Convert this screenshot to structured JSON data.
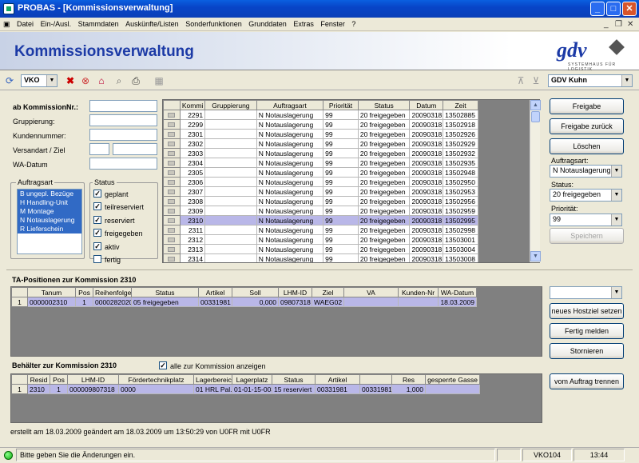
{
  "window": {
    "title": "PROBAS - [Kommissionsverwaltung]"
  },
  "menu": [
    "Datei",
    "Ein-/Ausl.",
    "Stammdaten",
    "Auskünfte/Listen",
    "Sonderfunktionen",
    "Grunddaten",
    "Extras",
    "Fenster",
    "?"
  ],
  "banner": {
    "title": "Kommissionsverwaltung",
    "logo": "gdv",
    "logo_sub": "SYSTEMHAUS FÜR LOGISTIK"
  },
  "toolbar": {
    "mode": "VKO",
    "user": "GDV Kuhn"
  },
  "filter": {
    "ab_label": "ab KommissionNr.:",
    "grupp_label": "Gruppierung:",
    "kunden_label": "Kundennummer:",
    "versand_label": "Versandart / Ziel",
    "wa_label": "WA-Datum",
    "auftragsart_title": "Auftragsart",
    "auftragsart": [
      "B  ungepl. Bezüge",
      "H  Handling-Unit",
      "M  Montage",
      "N  Notauslagerung",
      "R  Lieferschein"
    ],
    "status_title": "Status",
    "status": [
      {
        "label": "geplant",
        "checked": true
      },
      {
        "label": "teilreserviert",
        "checked": true
      },
      {
        "label": "reserviert",
        "checked": true
      },
      {
        "label": "freigegeben",
        "checked": true
      },
      {
        "label": "aktiv",
        "checked": true
      },
      {
        "label": "fertig",
        "checked": false
      }
    ]
  },
  "main_grid": {
    "columns": [
      "Kommi",
      "Gruppierung",
      "Auftragsart",
      "Priorität",
      "Status",
      "Datum",
      "Zeit"
    ],
    "rows": [
      [
        "2291",
        "",
        "N  Notauslagerung",
        "99",
        "20 freigegeben",
        "20090318",
        "13502885"
      ],
      [
        "2299",
        "",
        "N  Notauslagerung",
        "99",
        "20 freigegeben",
        "20090318",
        "13502918"
      ],
      [
        "2301",
        "",
        "N  Notauslagerung",
        "99",
        "20 freigegeben",
        "20090318",
        "13502926"
      ],
      [
        "2302",
        "",
        "N  Notauslagerung",
        "99",
        "20 freigegeben",
        "20090318",
        "13502929"
      ],
      [
        "2303",
        "",
        "N  Notauslagerung",
        "99",
        "20 freigegeben",
        "20090318",
        "13502932"
      ],
      [
        "2304",
        "",
        "N  Notauslagerung",
        "99",
        "20 freigegeben",
        "20090318",
        "13502935"
      ],
      [
        "2305",
        "",
        "N  Notauslagerung",
        "99",
        "20 freigegeben",
        "20090318",
        "13502948"
      ],
      [
        "2306",
        "",
        "N  Notauslagerung",
        "99",
        "20 freigegeben",
        "20090318",
        "13502950"
      ],
      [
        "2307",
        "",
        "N  Notauslagerung",
        "99",
        "20 freigegeben",
        "20090318",
        "13502953"
      ],
      [
        "2308",
        "",
        "N  Notauslagerung",
        "99",
        "20 freigegeben",
        "20090318",
        "13502956"
      ],
      [
        "2309",
        "",
        "N  Notauslagerung",
        "99",
        "20 freigegeben",
        "20090318",
        "13502959"
      ],
      [
        "2310",
        "",
        "N  Notauslagerung",
        "99",
        "20 freigegeben",
        "20090318",
        "13502995"
      ],
      [
        "2311",
        "",
        "N  Notauslagerung",
        "99",
        "20 freigegeben",
        "20090318",
        "13502998"
      ],
      [
        "2312",
        "",
        "N  Notauslagerung",
        "99",
        "20 freigegeben",
        "20090318",
        "13503001"
      ],
      [
        "2313",
        "",
        "N  Notauslagerung",
        "99",
        "20 freigegeben",
        "20090318",
        "13503004"
      ],
      [
        "2314",
        "",
        "N  Notauslagerung",
        "99",
        "20 freigegeben",
        "20090318",
        "13503008"
      ]
    ],
    "selected_row": 11
  },
  "right_panel": {
    "freigabe": "Freigabe",
    "freigabe_zurueck": "Freigabe zurück",
    "loeschen": "Löschen",
    "auftragsart_label": "Auftragsart:",
    "auftragsart_value": "N  Notauslagerung",
    "status_label": "Status:",
    "status_value": "20 freigegeben",
    "prio_label": "Priorität:",
    "prio_value": "99",
    "speichern": "Speichern"
  },
  "ta": {
    "title": "TA-Positionen zur Kommission  2310",
    "columns": [
      "Tanum",
      "Pos",
      "Reihenfolge",
      "Status",
      "Artikel",
      "Soll",
      "LHM-ID",
      "Ziel",
      "VA",
      "Kunden-Nr",
      "WA-Datum"
    ],
    "rows": [
      [
        "1",
        "0000002310",
        "1",
        "0000282020",
        "05 freigegeben",
        "00331981",
        "0,000",
        "09807318",
        "WAEG02",
        "",
        "",
        "18.03.2009"
      ]
    ],
    "hostziel": "",
    "btn_hostziel": "neues Hostziel setzen",
    "btn_fertig": "Fertig melden",
    "btn_storno": "Stornieren"
  },
  "beh": {
    "title": "Behälter zur Kommission  2310",
    "alle_label": "alle zur Kommission anzeigen",
    "alle_checked": true,
    "columns": [
      "Resid",
      "Pos",
      "LHM-ID",
      "Fördertechnikplatz",
      "Lagerbereic",
      "Lagerplatz",
      "Status",
      "Artikel",
      "",
      "Res",
      "gesperrte Gasse"
    ],
    "rows": [
      [
        "1",
        "2310",
        "1",
        "000009807318",
        "0000",
        "01 HRL Pal.-",
        "01-01-15-003",
        "15 reserviert",
        "00331981",
        "00331981",
        "1,000",
        ""
      ]
    ],
    "btn_trennen": "vom Auftrag trennen"
  },
  "footer": {
    "created": "erstellt am 18.03.2009 geändert am 18.03.2009  um 13:50:29 von U0FR mit U0FR"
  },
  "statusbar": {
    "message": "Bitte geben Sie die Änderungen ein.",
    "panel2": "",
    "code": "VKO104",
    "time": "13:44"
  }
}
